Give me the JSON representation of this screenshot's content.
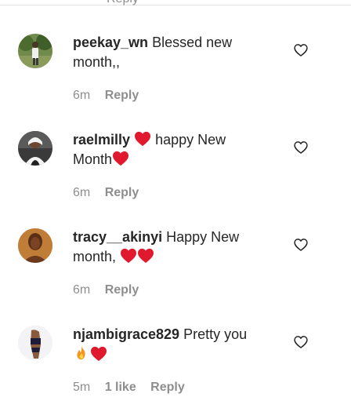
{
  "truncated_top_text": "Reply",
  "comments": [
    {
      "username": "peekay_wn",
      "text_line1": "Blessed new",
      "text_line2": "month,,",
      "time": "6m",
      "likes": "",
      "reply": "Reply",
      "avatar_icon": "profile-photo-outdoor"
    },
    {
      "username": "raelmilly",
      "text_line1": "happy New",
      "text_line2": "Month",
      "time": "6m",
      "likes": "",
      "reply": "Reply",
      "avatar_icon": "profile-photo-person"
    },
    {
      "username": "tracy__akinyi",
      "text_line1": "Happy New",
      "text_line2": "month,",
      "time": "6m",
      "likes": "",
      "reply": "Reply",
      "avatar_icon": "profile-photo-portrait"
    },
    {
      "username": "njambigrace829",
      "text_line1": "Pretty you",
      "text_line2": "",
      "time": "5m",
      "likes": "1 like",
      "reply": "Reply",
      "avatar_icon": "profile-photo-figure"
    }
  ],
  "colors": {
    "heart_red": "#e0192e",
    "fire_orange": "#f7931e",
    "meta_gray": "#8e8e8e",
    "text_dark": "#262626"
  }
}
